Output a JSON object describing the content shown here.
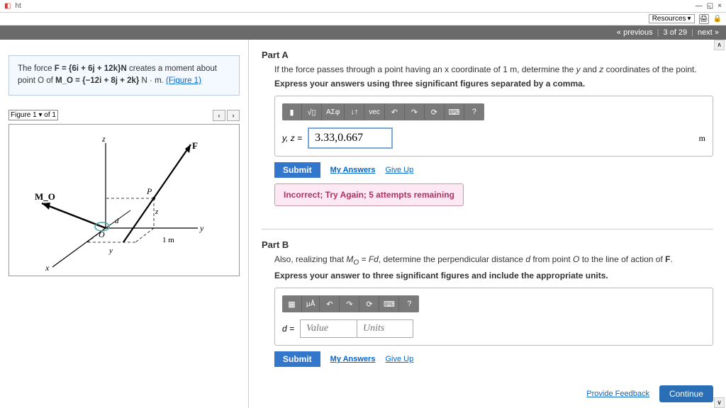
{
  "window": {
    "tab_prefix": "ht",
    "minimize": "—",
    "maximize": "◱",
    "close": "×",
    "lock": "🔒"
  },
  "toolbar_top": {
    "resources": "Resources",
    "print": "🖨"
  },
  "nav": {
    "previous": "« previous",
    "position": "3 of 29",
    "next": "next »"
  },
  "problem": {
    "text_pre": "The force ",
    "F_expr": "F = {6i + 6j + 12k}N",
    "text_mid": " creates a moment about point O of ",
    "M_expr": "M_O = {−12i + 8j + 2k}",
    "text_post": " N · m. ",
    "fig_link": "(Figure 1)"
  },
  "figure": {
    "select": "Figure 1",
    "of": "of 1",
    "prev": "‹",
    "next": "›",
    "labels": {
      "z": "z",
      "F": "F",
      "P": "P",
      "Mo": "M_O",
      "d": "d",
      "O": "O",
      "y": "y",
      "x": "x",
      "one_m": "1 m"
    }
  },
  "partA": {
    "title": "Part A",
    "desc": "If the force passes through a point having an x coordinate of 1 m, determine the y and z coordinates of the point.",
    "inst": "Express your answers using three significant figures separated by a comma.",
    "toolbar": {
      "t1": "▮",
      "t2": "√▯",
      "t3": "ΑΣφ",
      "t4": "↓↑",
      "t5": "vec",
      "undo": "↶",
      "redo": "↷",
      "reset": "⟳",
      "kbd": "⌨",
      "help": "?"
    },
    "var_label": "y, z =",
    "answer": "3.33,0.667",
    "unit": "m",
    "submit": "Submit",
    "my_answers": "My Answers",
    "give_up": "Give Up",
    "feedback": "Incorrect; Try Again; 5 attempts remaining"
  },
  "partB": {
    "title": "Part B",
    "desc": "Also, realizing that M_O = Fd, determine the perpendicular distance d from point O to the line of action of F.",
    "inst": "Express your answer to three significant figures and include the appropriate units.",
    "toolbar": {
      "t1": "▦",
      "t2": "μÅ",
      "undo": "↶",
      "redo": "↷",
      "reset": "⟳",
      "kbd": "⌨",
      "help": "?"
    },
    "var_label": "d =",
    "value_ph": "Value",
    "units_ph": "Units",
    "submit": "Submit",
    "my_answers": "My Answers",
    "give_up": "Give Up"
  },
  "footer": {
    "provide_feedback": "Provide Feedback",
    "continue": "Continue"
  }
}
